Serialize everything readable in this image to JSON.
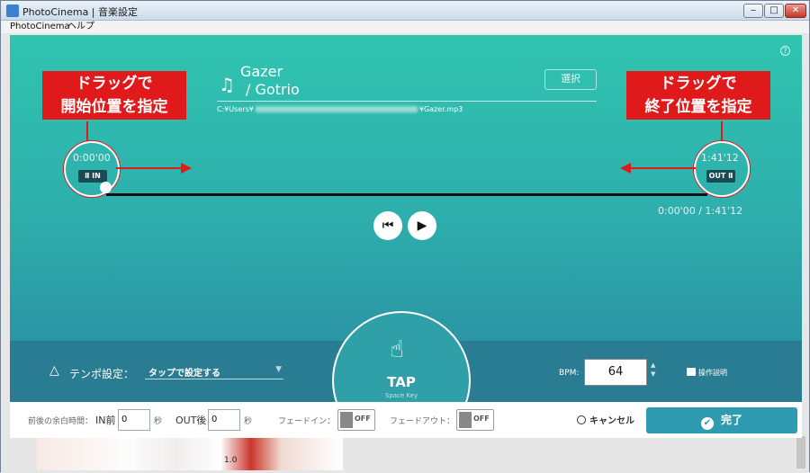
{
  "window": {
    "title": "PhotoCinema | 音楽設定",
    "controls": {
      "min": "‒",
      "max": "□",
      "close": "✕"
    }
  },
  "menu": {
    "items": [
      "PhotoCinema",
      "ヘルプ"
    ]
  },
  "help": "?",
  "song": {
    "title": "Gazer",
    "artist": "/ Gotrio",
    "path_prefix": "C:¥Users¥",
    "path_suffix": "¥Gazer.mp3",
    "select_label": "選択"
  },
  "callouts": {
    "start_line1": "ドラッグで",
    "start_line2": "開始位置を指定",
    "end_line1": "ドラッグで",
    "end_line2": "終了位置を指定"
  },
  "playback": {
    "in_time": "0:00'00",
    "out_time": "1:41'12",
    "in_label": "Ⅱ IN",
    "out_label": "OUT Ⅱ",
    "position": "0:00'00 / 1:41'12",
    "rewind_icon": "⏮",
    "play_icon": "▶"
  },
  "tempo": {
    "label": "テンポ設定：",
    "value": "タップで設定する",
    "caret": "▼",
    "icon": "🎼"
  },
  "tap": {
    "label": "TAP",
    "sub": "Space Key",
    "hand": "☝"
  },
  "bpm": {
    "label": "BPM:",
    "value": "64",
    "spin": "▲\n▼"
  },
  "howto": {
    "label": "操作説明"
  },
  "footer": {
    "margin_label": "前後の余白時間：",
    "in_label": "IN前",
    "in_value": "0",
    "in_unit": "秒",
    "out_label": "OUT後",
    "out_value": "0",
    "out_unit": "秒",
    "fadein_label": "フェードイン：",
    "fadein_state": "OFF",
    "fadeout_label": "フェードアウト：",
    "fadeout_state": "OFF",
    "cancel_label": "キャンセル",
    "done_label": "完了",
    "done_check": "✔"
  },
  "background": {
    "zoom": "1.0"
  }
}
